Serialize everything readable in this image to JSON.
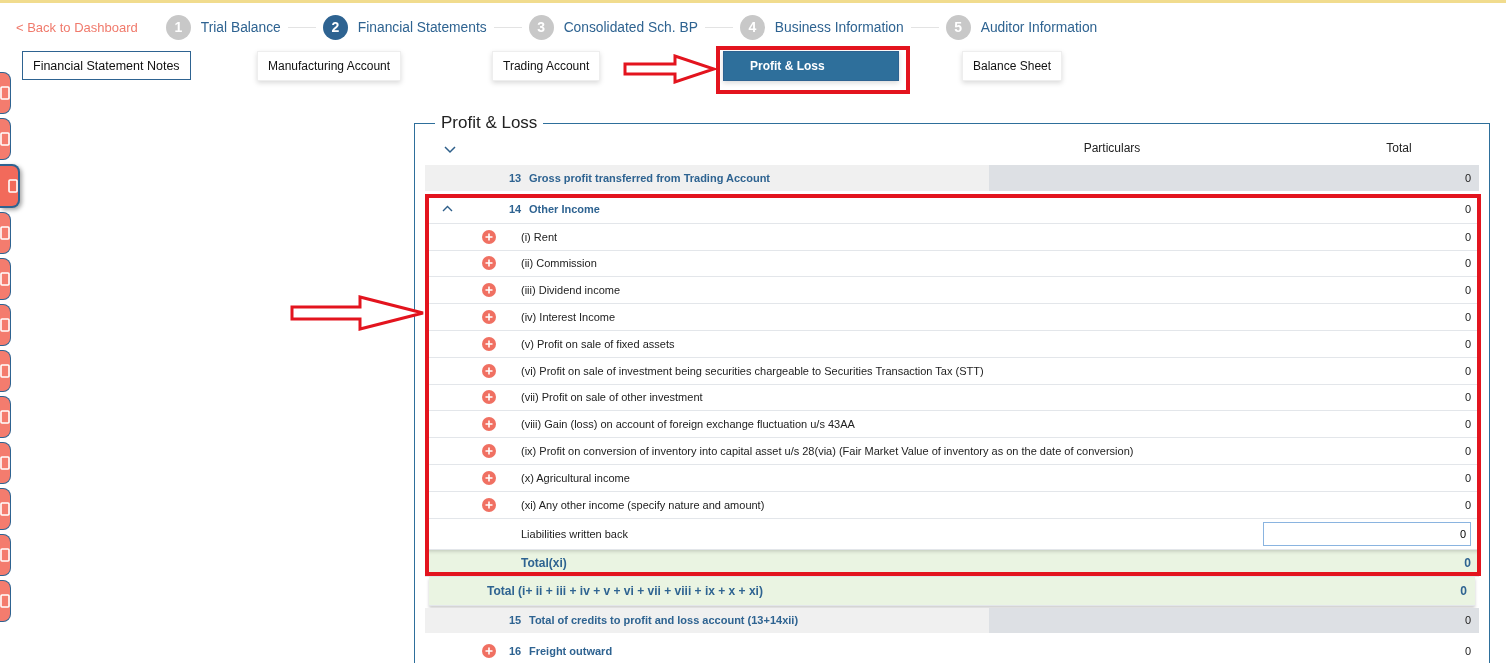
{
  "stepper": {
    "back_link": "< Back to Dashboard",
    "steps": [
      {
        "number": "1",
        "label": "Trial Balance",
        "selected": false
      },
      {
        "number": "2",
        "label": "Financial Statements",
        "selected": true
      },
      {
        "number": "3",
        "label": "Consolidated Sch. BP",
        "selected": false
      },
      {
        "number": "4",
        "label": "Business Information",
        "selected": false
      },
      {
        "number": "5",
        "label": "Auditor Information",
        "selected": false
      }
    ]
  },
  "side_rail": {
    "items": [
      {
        "selected": false
      },
      {
        "selected": false
      },
      {
        "selected": true
      },
      {
        "selected": false
      },
      {
        "selected": false
      },
      {
        "selected": false
      },
      {
        "selected": false
      },
      {
        "selected": false
      },
      {
        "selected": false
      },
      {
        "selected": false
      },
      {
        "selected": false
      },
      {
        "selected": false
      }
    ]
  },
  "statement_tabs": [
    {
      "label": "Financial Statement Notes",
      "kind": "outlined",
      "selected": false
    },
    {
      "label": "Manufacturing Account",
      "kind": "card",
      "selected": false
    },
    {
      "label": "Trading Account",
      "kind": "card",
      "selected": false
    },
    {
      "label": "Profit & Loss",
      "kind": "card",
      "selected": true
    },
    {
      "label": "Balance Sheet",
      "kind": "card",
      "selected": false
    }
  ],
  "panel": {
    "title": "Profit & Loss",
    "header_expanded": false,
    "columns": [
      "Particulars",
      "Total"
    ],
    "rows": [
      {
        "kind": "section",
        "number": "13",
        "label": "Gross profit transferred from Trading Account",
        "total": "0"
      },
      {
        "kind": "group",
        "number": "14",
        "label": "Other Income",
        "expanded": true,
        "total": "0"
      },
      {
        "kind": "item",
        "label": "(i) Rent",
        "total": "0"
      },
      {
        "kind": "item",
        "label": "(ii) Commission",
        "total": "0"
      },
      {
        "kind": "item",
        "label": "(iii) Dividend income",
        "total": "0"
      },
      {
        "kind": "item",
        "label": "(iv) Interest Income",
        "total": "0"
      },
      {
        "kind": "item",
        "label": "(v) Profit on sale of fixed assets",
        "total": "0"
      },
      {
        "kind": "item",
        "label": "(vi) Profit on sale of investment being securities chargeable to Securities Transaction Tax (STT)",
        "total": "0"
      },
      {
        "kind": "item",
        "label": "(vii) Profit on sale of other investment",
        "total": "0"
      },
      {
        "kind": "item",
        "label": "(viii) Gain (loss) on account of foreign exchange fluctuation u/s 43AA",
        "total": "0"
      },
      {
        "kind": "item",
        "label": "(ix) Profit on conversion of inventory into capital asset u/s 28(via) (Fair Market Value of inventory as on the date of conversion)",
        "total": "0"
      },
      {
        "kind": "item",
        "label": "(x) Agricultural income",
        "total": "0"
      },
      {
        "kind": "item",
        "label": "(xi) Any other income (specify nature and amount)",
        "total": "0"
      },
      {
        "kind": "input",
        "label": "Liabilities written back",
        "total": "0"
      },
      {
        "kind": "subtotal",
        "label": "Total(xi)",
        "total": "0"
      },
      {
        "kind": "total",
        "label": "Total (i+ ii + iii + iv + v + vi + vii + viii + ix + x + xi)",
        "total": "0"
      },
      {
        "kind": "section",
        "number": "15",
        "label": "Total of credits to profit and loss account (13+14xii)",
        "total": "0"
      },
      {
        "kind": "add-heading",
        "number": "16",
        "label": "Freight outward",
        "total": "0"
      }
    ]
  }
}
